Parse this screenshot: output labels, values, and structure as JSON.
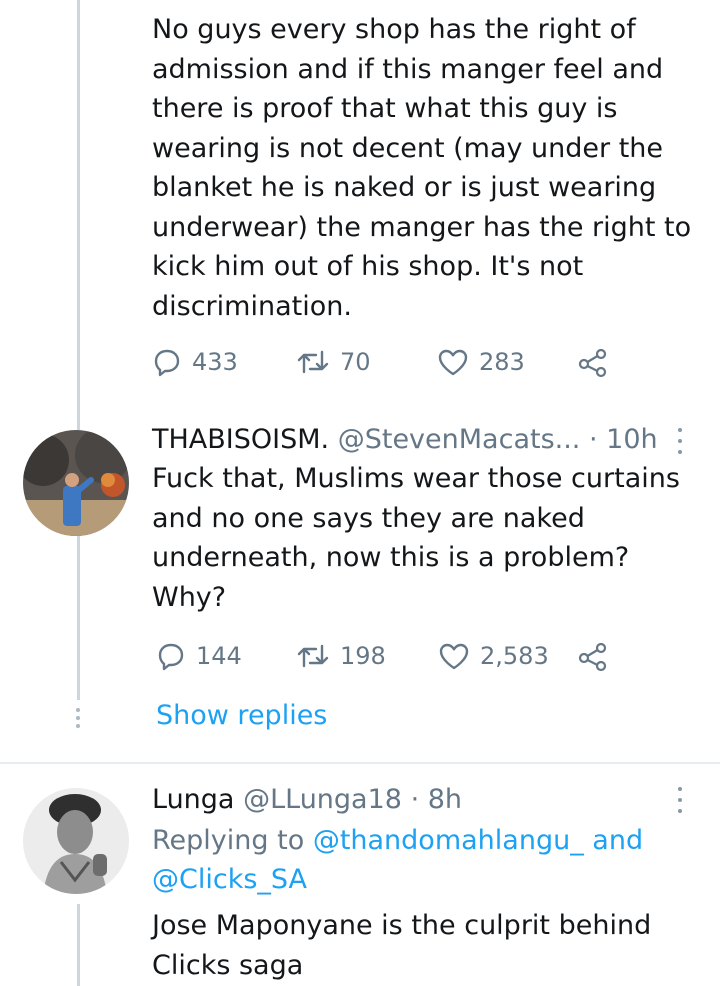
{
  "tweet1": {
    "text": "No guys every shop has the right of\nadmission and if this manger feel and\nthere is proof that what this guy is\nwearing is not decent (may under the\nblanket he is naked or is just wearing\nunderwear) the manger has the right to\nkick him out of his shop. It's not\ndiscrimination.",
    "replies": "433",
    "retweets": "70",
    "likes": "283"
  },
  "tweet2": {
    "name": "THABISOISM.",
    "handle": "@StevenMacats...",
    "time": "· 10h",
    "text": "Fuck that, Muslims wear those curtains\nand no one says they are naked\nunderneath, now this is a problem?\nWhy?",
    "replies": "144",
    "retweets": "198",
    "likes": "2,583"
  },
  "show_replies": "Show replies",
  "tweet3": {
    "name": "Lunga",
    "handle": "@LLunga18",
    "time": "· 8h",
    "replying_prefix": "Replying to",
    "replying_user1": "@thandomahlangu_",
    "replying_and": "and",
    "replying_user2": "@Clicks_SA",
    "text": "Jose Maponyane is the culprit behind\nClicks saga"
  },
  "icons": {
    "reply": "reply-icon",
    "retweet": "retweet-icon",
    "like": "heart-icon",
    "share": "share-icon",
    "menu": "more-vertical-icon"
  },
  "colors": {
    "link": "#1da1f2",
    "muted": "#657786",
    "thread_line": "#cdd6dd"
  }
}
